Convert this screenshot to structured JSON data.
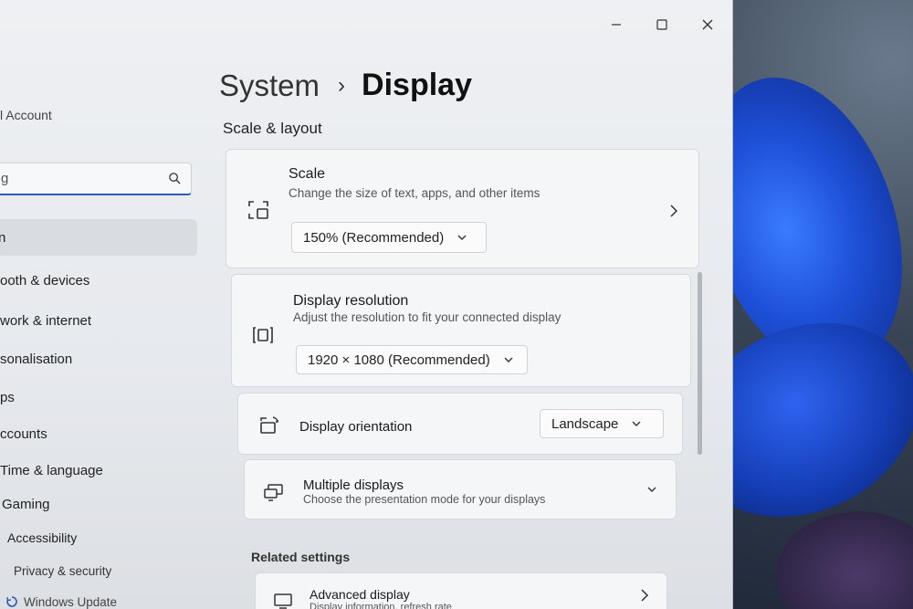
{
  "window": {
    "minimize_label": "—",
    "maximize_label": "☐",
    "close_label": "✕"
  },
  "nav": {
    "account": "l Account",
    "search_value": "g",
    "items": [
      {
        "label": "n",
        "selected": true
      },
      {
        "label": "ooth & devices"
      },
      {
        "label": "work & internet"
      },
      {
        "label": "sonalisation"
      },
      {
        "label": "ps"
      },
      {
        "label": "ccounts"
      },
      {
        "label": "Time & language"
      },
      {
        "label": "Gaming"
      },
      {
        "label": "Accessibility"
      },
      {
        "label": "Privacy & security"
      },
      {
        "label": "Windows Update"
      }
    ]
  },
  "header": {
    "breadcrumb_parent": "System",
    "breadcrumb_sep": "›",
    "breadcrumb_current": "Display"
  },
  "sections": {
    "scale_layout": "Scale & layout",
    "related": "Related settings"
  },
  "scale": {
    "title": "Scale",
    "subtitle": "Change the size of text, apps, and other items",
    "value": "150% (Recommended)"
  },
  "resolution": {
    "title": "Display resolution",
    "subtitle": "Adjust the resolution to fit your connected display",
    "value": "1920 × 1080 (Recommended)"
  },
  "orientation": {
    "title": "Display orientation",
    "value": "Landscape"
  },
  "multiple": {
    "title": "Multiple displays",
    "subtitle": "Choose the presentation mode for your displays"
  },
  "advanced": {
    "title": "Advanced display",
    "subtitle": "Display information, refresh rate"
  },
  "colors": {
    "accent": "#2a5cb8",
    "window_bg": "#eef0f3"
  }
}
